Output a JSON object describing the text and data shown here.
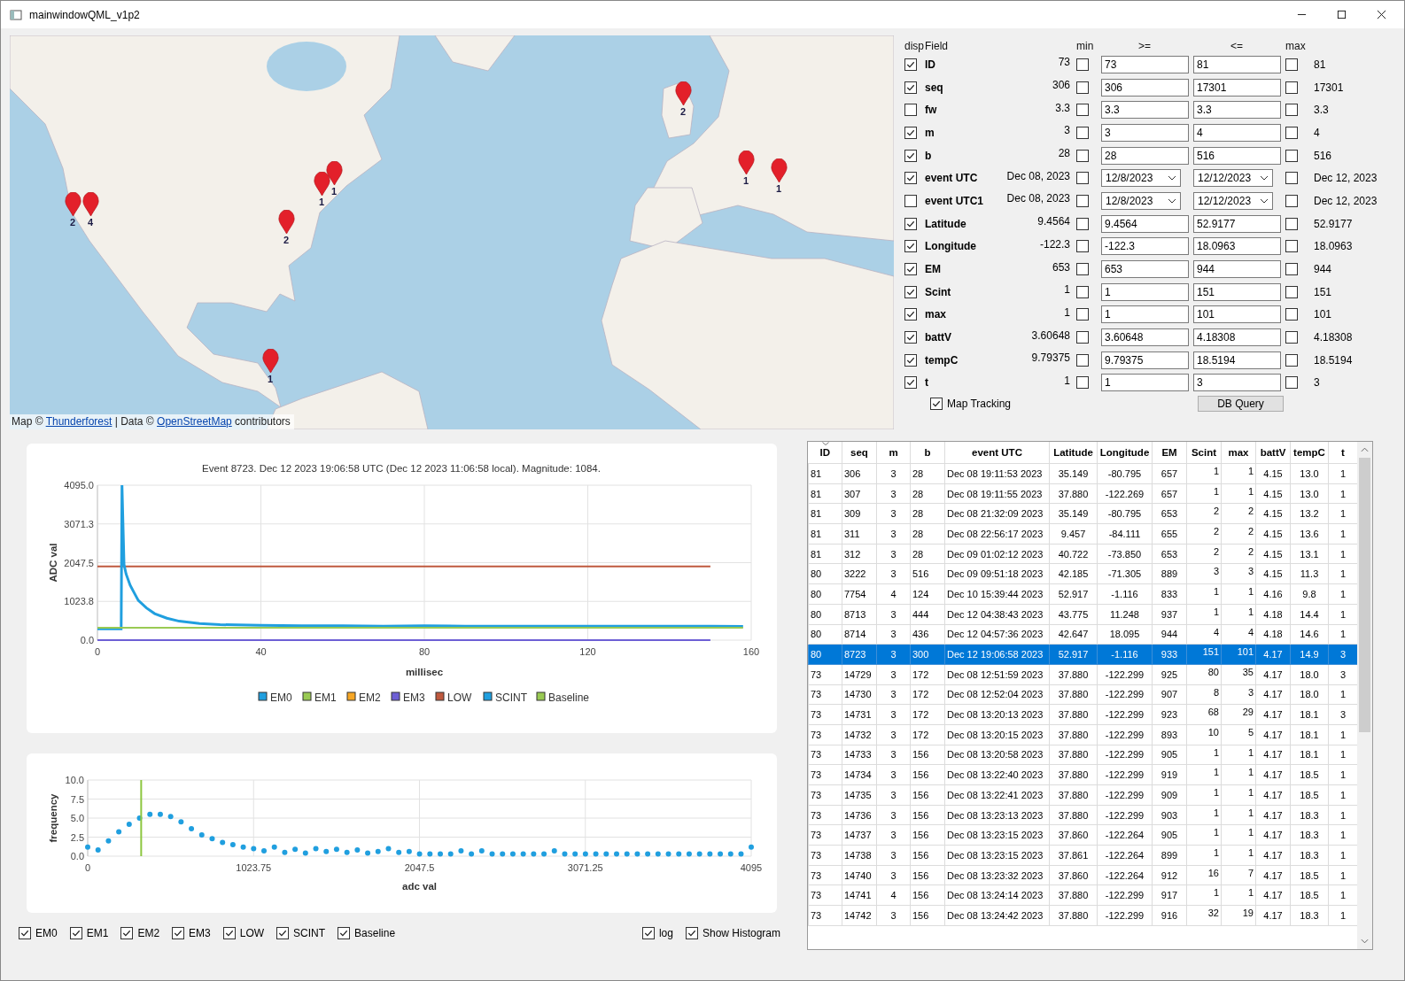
{
  "window": {
    "title": "mainwindowQML_v1p2"
  },
  "map": {
    "markers": [
      {
        "count": "2"
      },
      {
        "count": "4"
      },
      {
        "count": "1"
      },
      {
        "count": "1"
      },
      {
        "count": "2"
      },
      {
        "count": "1"
      },
      {
        "count": "2"
      },
      {
        "count": "1"
      },
      {
        "count": "1"
      }
    ],
    "attribution": [
      {
        "text": "Map ©",
        "link": false
      },
      {
        "text": "Thunderforest",
        "link": true
      },
      {
        "text": "| Data ©",
        "link": false
      },
      {
        "text": "OpenStreetMap",
        "link": true
      },
      {
        "text": "contributors",
        "link": false
      }
    ]
  },
  "filter": {
    "headers": [
      "disp",
      "Field",
      "min",
      ">=",
      "<=",
      "max"
    ],
    "rows": [
      {
        "field": "ID",
        "disp": true,
        "min": "73",
        "min_checked": false,
        "from": "73",
        "to": "81",
        "max_checked": false,
        "max": "81",
        "kind": "text"
      },
      {
        "field": "seq",
        "disp": true,
        "min": "306",
        "min_checked": false,
        "from": "306",
        "to": "17301",
        "max_checked": false,
        "max": "17301",
        "kind": "text"
      },
      {
        "field": "fw",
        "disp": false,
        "min": "3.3",
        "min_checked": false,
        "from": "3.3",
        "to": "3.3",
        "max_checked": false,
        "max": "3.3",
        "kind": "text"
      },
      {
        "field": "m",
        "disp": true,
        "min": "3",
        "min_checked": false,
        "from": "3",
        "to": "4",
        "max_checked": false,
        "max": "4",
        "kind": "text"
      },
      {
        "field": "b",
        "disp": true,
        "min": "28",
        "min_checked": false,
        "from": "28",
        "to": "516",
        "max_checked": false,
        "max": "516",
        "kind": "text"
      },
      {
        "field": "event UTC",
        "disp": true,
        "min": "Dec 08, 2023",
        "min_checked": false,
        "from": "12/8/2023",
        "to": "12/12/2023",
        "max_checked": false,
        "max": "Dec 12, 2023",
        "kind": "date"
      },
      {
        "field": "event UTC1",
        "disp": false,
        "min": "Dec 08, 2023",
        "min_checked": false,
        "from": "12/8/2023",
        "to": "12/12/2023",
        "max_checked": false,
        "max": "Dec 12, 2023",
        "kind": "date"
      },
      {
        "field": "Latitude",
        "disp": true,
        "min": "9.4564",
        "min_checked": false,
        "from": "9.4564",
        "to": "52.9177",
        "max_checked": false,
        "max": "52.9177",
        "kind": "text"
      },
      {
        "field": "Longitude",
        "disp": true,
        "min": "-122.3",
        "min_checked": false,
        "from": "-122.3",
        "to": "18.0963",
        "max_checked": false,
        "max": "18.0963",
        "kind": "text"
      },
      {
        "field": "EM",
        "disp": true,
        "min": "653",
        "min_checked": false,
        "from": "653",
        "to": "944",
        "max_checked": false,
        "max": "944",
        "kind": "text"
      },
      {
        "field": "Scint",
        "disp": true,
        "min": "1",
        "min_checked": false,
        "from": "1",
        "to": "151",
        "max_checked": false,
        "max": "151",
        "kind": "text"
      },
      {
        "field": "max",
        "disp": true,
        "min": "1",
        "min_checked": false,
        "from": "1",
        "to": "101",
        "max_checked": false,
        "max": "101",
        "kind": "text"
      },
      {
        "field": "battV",
        "disp": true,
        "min": "3.60648",
        "min_checked": false,
        "from": "3.60648",
        "to": "4.18308",
        "max_checked": false,
        "max": "4.18308",
        "kind": "text"
      },
      {
        "field": "tempC",
        "disp": true,
        "min": "9.79375",
        "min_checked": false,
        "from": "9.79375",
        "to": "18.5194",
        "max_checked": false,
        "max": "18.5194",
        "kind": "text"
      },
      {
        "field": "t",
        "disp": true,
        "min": "1",
        "min_checked": false,
        "from": "1",
        "to": "3",
        "max_checked": false,
        "max": "3",
        "kind": "text"
      }
    ],
    "map_tracking": {
      "label": "Map Tracking",
      "checked": true
    },
    "query_button": "DB Query"
  },
  "waveform": {
    "chart_data": {
      "type": "line",
      "title": "Event 8723. Dec 12 2023 19:06:58 UTC (Dec 12 2023 11:06:58 local). Magnitude: 1084.",
      "xlabel": "millisec",
      "ylabel": "ADC val",
      "x": [
        0,
        2,
        4,
        5.8,
        6,
        6.5,
        7,
        8,
        9,
        10,
        12,
        14,
        17,
        20,
        25,
        30,
        40,
        50,
        60,
        70,
        80,
        90,
        100,
        110,
        120,
        130,
        140,
        150,
        158
      ],
      "series": [
        {
          "name": "EM0",
          "color": "#209fdf",
          "values": [
            null,
            null,
            null,
            null,
            null,
            null,
            null,
            null,
            null,
            null,
            null,
            null,
            null,
            null,
            null,
            null,
            null,
            null,
            null,
            null,
            null,
            null,
            null,
            null,
            null,
            null,
            null,
            null,
            null
          ]
        },
        {
          "name": "EM1",
          "color": "#99ca53",
          "values": [
            null,
            null,
            null,
            null,
            null,
            null,
            null,
            null,
            null,
            null,
            null,
            null,
            null,
            null,
            null,
            null,
            null,
            null,
            null,
            null,
            null,
            null,
            null,
            null,
            null,
            null,
            null,
            null,
            null
          ]
        },
        {
          "name": "EM2",
          "color": "#f6a625",
          "values": [
            null,
            null,
            null,
            null,
            null,
            null,
            null,
            null,
            null,
            null,
            null,
            null,
            null,
            null,
            null,
            null,
            null,
            null,
            null,
            null,
            null,
            null,
            null,
            null,
            null,
            null,
            null,
            null,
            null
          ]
        },
        {
          "name": "EM3",
          "color": "#6d5fd5",
          "values": [
            0,
            0,
            0,
            0,
            0,
            0,
            0,
            0,
            0,
            0,
            0,
            0,
            0,
            0,
            0,
            0,
            0,
            0,
            0,
            0,
            0,
            0,
            0,
            0,
            0,
            0,
            0,
            0,
            null
          ]
        },
        {
          "name": "LOW",
          "color": "#bf593e",
          "values": [
            1950,
            1950,
            1950,
            1950,
            1950,
            1950,
            1950,
            1950,
            1950,
            1950,
            1950,
            1950,
            1950,
            1950,
            1950,
            1950,
            1950,
            1950,
            1950,
            1950,
            1950,
            1950,
            1950,
            1950,
            1950,
            1950,
            1950,
            1950,
            null
          ]
        },
        {
          "name": "SCINT",
          "color": "#209fdf",
          "values": [
            300,
            300,
            300,
            300,
            4095,
            2000,
            1750,
            1450,
            1250,
            1050,
            850,
            700,
            580,
            500,
            440,
            410,
            390,
            380,
            380,
            370,
            380,
            370,
            370,
            370,
            370,
            370,
            370,
            370,
            360
          ]
        },
        {
          "name": "Baseline",
          "color": "#99ca53",
          "values": [
            330,
            330,
            330,
            330,
            330,
            330,
            330,
            330,
            330,
            330,
            330,
            330,
            330,
            330,
            330,
            330,
            330,
            330,
            330,
            330,
            330,
            330,
            330,
            330,
            330,
            330,
            330,
            330,
            330
          ]
        }
      ],
      "legend": true,
      "grid": true,
      "xlim": [
        0,
        160
      ],
      "ylim": [
        0,
        4095
      ],
      "xticks": [
        0,
        40,
        80,
        120,
        160
      ],
      "yticks": [
        {
          "value": 0,
          "label": "0.0"
        },
        {
          "value": 1023.75,
          "label": "1023.8"
        },
        {
          "value": 2047.5,
          "label": "2047.5"
        },
        {
          "value": 3071.25,
          "label": "3071.3"
        },
        {
          "value": 4095,
          "label": "4095.0"
        }
      ]
    }
  },
  "histogram": {
    "chart_data": {
      "type": "scatter",
      "xlabel": "adc val",
      "ylabel": "frequency",
      "x": [
        0,
        64,
        128,
        192,
        256,
        320,
        384,
        448,
        512,
        576,
        640,
        704,
        768,
        832,
        896,
        960,
        1024,
        1088,
        1152,
        1216,
        1280,
        1344,
        1408,
        1472,
        1536,
        1600,
        1664,
        1728,
        1792,
        1856,
        1920,
        1984,
        2048,
        2112,
        2176,
        2240,
        2304,
        2368,
        2432,
        2496,
        2560,
        2624,
        2688,
        2752,
        2816,
        2880,
        2944,
        3008,
        3072,
        3136,
        3200,
        3264,
        3328,
        3392,
        3456,
        3520,
        3584,
        3648,
        3712,
        3776,
        3840,
        3904,
        3968,
        4032,
        4095
      ],
      "series": [
        {
          "color": "#209fdf",
          "values": [
            1.2,
            0.8,
            2.0,
            3.2,
            4.2,
            5.0,
            5.5,
            5.5,
            5.2,
            4.5,
            3.6,
            2.8,
            2.3,
            1.8,
            1.5,
            1.2,
            1.0,
            0.7,
            1.2,
            0.5,
            0.9,
            0.4,
            1.0,
            0.6,
            0.9,
            0.5,
            0.8,
            0.4,
            0.6,
            1.0,
            0.5,
            0.6,
            0.3,
            0.3,
            0.3,
            0.3,
            0.7,
            0.3,
            0.7,
            0.3,
            0.3,
            0.3,
            0.3,
            0.3,
            0.3,
            0.7,
            0.3,
            0.3,
            0.3,
            0.3,
            0.3,
            0.3,
            0.3,
            0.3,
            0.3,
            0.3,
            0.3,
            0.3,
            0.3,
            0.3,
            0.3,
            0.3,
            0.3,
            0.3,
            1.2
          ]
        }
      ],
      "grid": true,
      "xlim": [
        0,
        4095
      ],
      "ylim": [
        0,
        10
      ],
      "xticks": [
        0,
        1023.75,
        2047.5,
        3071.25,
        4095
      ],
      "yticks": [
        {
          "value": 0,
          "label": "0.0"
        },
        {
          "value": 2.5,
          "label": "2.5"
        },
        {
          "value": 5,
          "label": "5.0"
        },
        {
          "value": 7.5,
          "label": "7.5"
        },
        {
          "value": 10,
          "label": "10.0"
        }
      ],
      "ref_lines": [
        {
          "axis": "x",
          "value": 330,
          "color": "#8cc63f"
        }
      ]
    }
  },
  "series_toggles": [
    {
      "label": "EM0",
      "checked": true
    },
    {
      "label": "EM1",
      "checked": true
    },
    {
      "label": "EM2",
      "checked": true
    },
    {
      "label": "EM3",
      "checked": true
    },
    {
      "label": "LOW",
      "checked": true
    },
    {
      "label": "SCINT",
      "checked": true
    },
    {
      "label": "Baseline",
      "checked": true
    }
  ],
  "view_toggles": [
    {
      "label": "log",
      "checked": true
    },
    {
      "label": "Show Histogram",
      "checked": true
    }
  ],
  "table": {
    "columns": [
      "ID",
      "seq",
      "m",
      "b",
      "event UTC",
      "Latitude",
      "Longitude",
      "EM",
      "Scint",
      "max",
      "battV",
      "tempC",
      "t"
    ],
    "rows": [
      {
        "selected": false,
        "cells": [
          "81",
          "306",
          "3",
          "28",
          "Dec 08 19:11:53 2023",
          "35.149",
          "-80.795",
          "657",
          "1",
          "1",
          "4.15",
          "13.0",
          "1"
        ]
      },
      {
        "selected": false,
        "cells": [
          "81",
          "307",
          "3",
          "28",
          "Dec 08 19:11:55 2023",
          "37.880",
          "-122.269",
          "657",
          "1",
          "1",
          "4.15",
          "13.0",
          "1"
        ]
      },
      {
        "selected": false,
        "cells": [
          "81",
          "309",
          "3",
          "28",
          "Dec 08 21:32:09 2023",
          "35.149",
          "-80.795",
          "653",
          "2",
          "2",
          "4.15",
          "13.2",
          "1"
        ]
      },
      {
        "selected": false,
        "cells": [
          "81",
          "311",
          "3",
          "28",
          "Dec 08 22:56:17 2023",
          "9.457",
          "-84.111",
          "655",
          "2",
          "2",
          "4.15",
          "13.6",
          "1"
        ]
      },
      {
        "selected": false,
        "cells": [
          "81",
          "312",
          "3",
          "28",
          "Dec 09 01:02:12 2023",
          "40.722",
          "-73.850",
          "653",
          "2",
          "2",
          "4.15",
          "13.1",
          "1"
        ]
      },
      {
        "selected": false,
        "cells": [
          "80",
          "3222",
          "3",
          "516",
          "Dec 09 09:51:18 2023",
          "42.185",
          "-71.305",
          "889",
          "3",
          "3",
          "4.15",
          "11.3",
          "1"
        ]
      },
      {
        "selected": false,
        "cells": [
          "80",
          "7754",
          "4",
          "124",
          "Dec 10 15:39:44 2023",
          "52.917",
          "-1.116",
          "833",
          "1",
          "1",
          "4.16",
          "9.8",
          "1"
        ]
      },
      {
        "selected": false,
        "cells": [
          "80",
          "8713",
          "3",
          "444",
          "Dec 12 04:38:43 2023",
          "43.775",
          "11.248",
          "937",
          "1",
          "1",
          "4.18",
          "14.4",
          "1"
        ]
      },
      {
        "selected": false,
        "cells": [
          "80",
          "8714",
          "3",
          "436",
          "Dec 12 04:57:36 2023",
          "42.647",
          "18.095",
          "944",
          "4",
          "4",
          "4.18",
          "14.6",
          "1"
        ]
      },
      {
        "selected": true,
        "cells": [
          "80",
          "8723",
          "3",
          "300",
          "Dec 12 19:06:58 2023",
          "52.917",
          "-1.116",
          "933",
          "151",
          "101",
          "4.17",
          "14.9",
          "3"
        ]
      },
      {
        "selected": false,
        "cells": [
          "73",
          "14729",
          "3",
          "172",
          "Dec 08 12:51:59 2023",
          "37.880",
          "-122.299",
          "925",
          "80",
          "35",
          "4.17",
          "18.0",
          "3"
        ]
      },
      {
        "selected": false,
        "cells": [
          "73",
          "14730",
          "3",
          "172",
          "Dec 08 12:52:04 2023",
          "37.880",
          "-122.299",
          "907",
          "8",
          "3",
          "4.17",
          "18.0",
          "1"
        ]
      },
      {
        "selected": false,
        "cells": [
          "73",
          "14731",
          "3",
          "172",
          "Dec 08 13:20:13 2023",
          "37.880",
          "-122.299",
          "923",
          "68",
          "29",
          "4.17",
          "18.1",
          "3"
        ]
      },
      {
        "selected": false,
        "cells": [
          "73",
          "14732",
          "3",
          "172",
          "Dec 08 13:20:15 2023",
          "37.880",
          "-122.299",
          "893",
          "10",
          "5",
          "4.17",
          "18.1",
          "1"
        ]
      },
      {
        "selected": false,
        "cells": [
          "73",
          "14733",
          "3",
          "156",
          "Dec 08 13:20:58 2023",
          "37.880",
          "-122.299",
          "905",
          "1",
          "1",
          "4.17",
          "18.1",
          "1"
        ]
      },
      {
        "selected": false,
        "cells": [
          "73",
          "14734",
          "3",
          "156",
          "Dec 08 13:22:40 2023",
          "37.880",
          "-122.299",
          "919",
          "1",
          "1",
          "4.17",
          "18.5",
          "1"
        ]
      },
      {
        "selected": false,
        "cells": [
          "73",
          "14735",
          "3",
          "156",
          "Dec 08 13:22:41 2023",
          "37.880",
          "-122.299",
          "909",
          "1",
          "1",
          "4.17",
          "18.5",
          "1"
        ]
      },
      {
        "selected": false,
        "cells": [
          "73",
          "14736",
          "3",
          "156",
          "Dec 08 13:23:13 2023",
          "37.880",
          "-122.299",
          "903",
          "1",
          "1",
          "4.17",
          "18.3",
          "1"
        ]
      },
      {
        "selected": false,
        "cells": [
          "73",
          "14737",
          "3",
          "156",
          "Dec 08 13:23:15 2023",
          "37.860",
          "-122.264",
          "905",
          "1",
          "1",
          "4.17",
          "18.3",
          "1"
        ]
      },
      {
        "selected": false,
        "cells": [
          "73",
          "14738",
          "3",
          "156",
          "Dec 08 13:23:15 2023",
          "37.861",
          "-122.264",
          "899",
          "1",
          "1",
          "4.17",
          "18.3",
          "1"
        ]
      },
      {
        "selected": false,
        "cells": [
          "73",
          "14740",
          "3",
          "156",
          "Dec 08 13:23:32 2023",
          "37.860",
          "-122.264",
          "912",
          "16",
          "7",
          "4.17",
          "18.5",
          "1"
        ]
      },
      {
        "selected": false,
        "cells": [
          "73",
          "14741",
          "4",
          "156",
          "Dec 08 13:24:14 2023",
          "37.880",
          "-122.299",
          "917",
          "1",
          "1",
          "4.17",
          "18.5",
          "1"
        ]
      },
      {
        "selected": false,
        "cells": [
          "73",
          "14742",
          "3",
          "156",
          "Dec 08 13:24:42 2023",
          "37.880",
          "-122.299",
          "916",
          "32",
          "19",
          "4.17",
          "18.3",
          "1"
        ]
      }
    ]
  }
}
